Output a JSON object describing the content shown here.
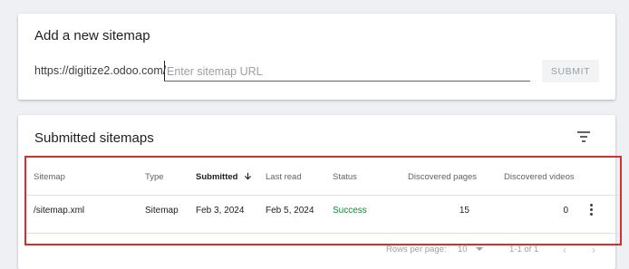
{
  "add_sitemap": {
    "title": "Add a new sitemap",
    "url_prefix": "https://digitize2.odoo.com/",
    "input_placeholder": "Enter sitemap URL",
    "input_value": "",
    "submit_label": "SUBMIT"
  },
  "submitted": {
    "title": "Submitted sitemaps",
    "filter_icon": "filter-list-icon",
    "columns": {
      "sitemap": "Sitemap",
      "type": "Type",
      "submitted": "Submitted",
      "last_read": "Last read",
      "status": "Status",
      "discovered_pages": "Discovered pages",
      "discovered_videos": "Discovered videos"
    },
    "sort_icon": "arrow-down-icon",
    "rows": [
      {
        "sitemap": "/sitemap.xml",
        "type": "Sitemap",
        "submitted": "Feb 3, 2024",
        "last_read": "Feb 5, 2024",
        "status": "Success",
        "discovered_pages": "15",
        "discovered_videos": "0"
      }
    ],
    "footer": {
      "rows_per_page_label": "Rows per page:",
      "rows_per_page_value": "10",
      "range": "1-1 of 1",
      "prev": "‹",
      "next": "›"
    }
  },
  "colors": {
    "accent": "#1a73e8",
    "success": "#188038",
    "highlight_box": "#d32f2f",
    "background": "#eef0f3"
  }
}
